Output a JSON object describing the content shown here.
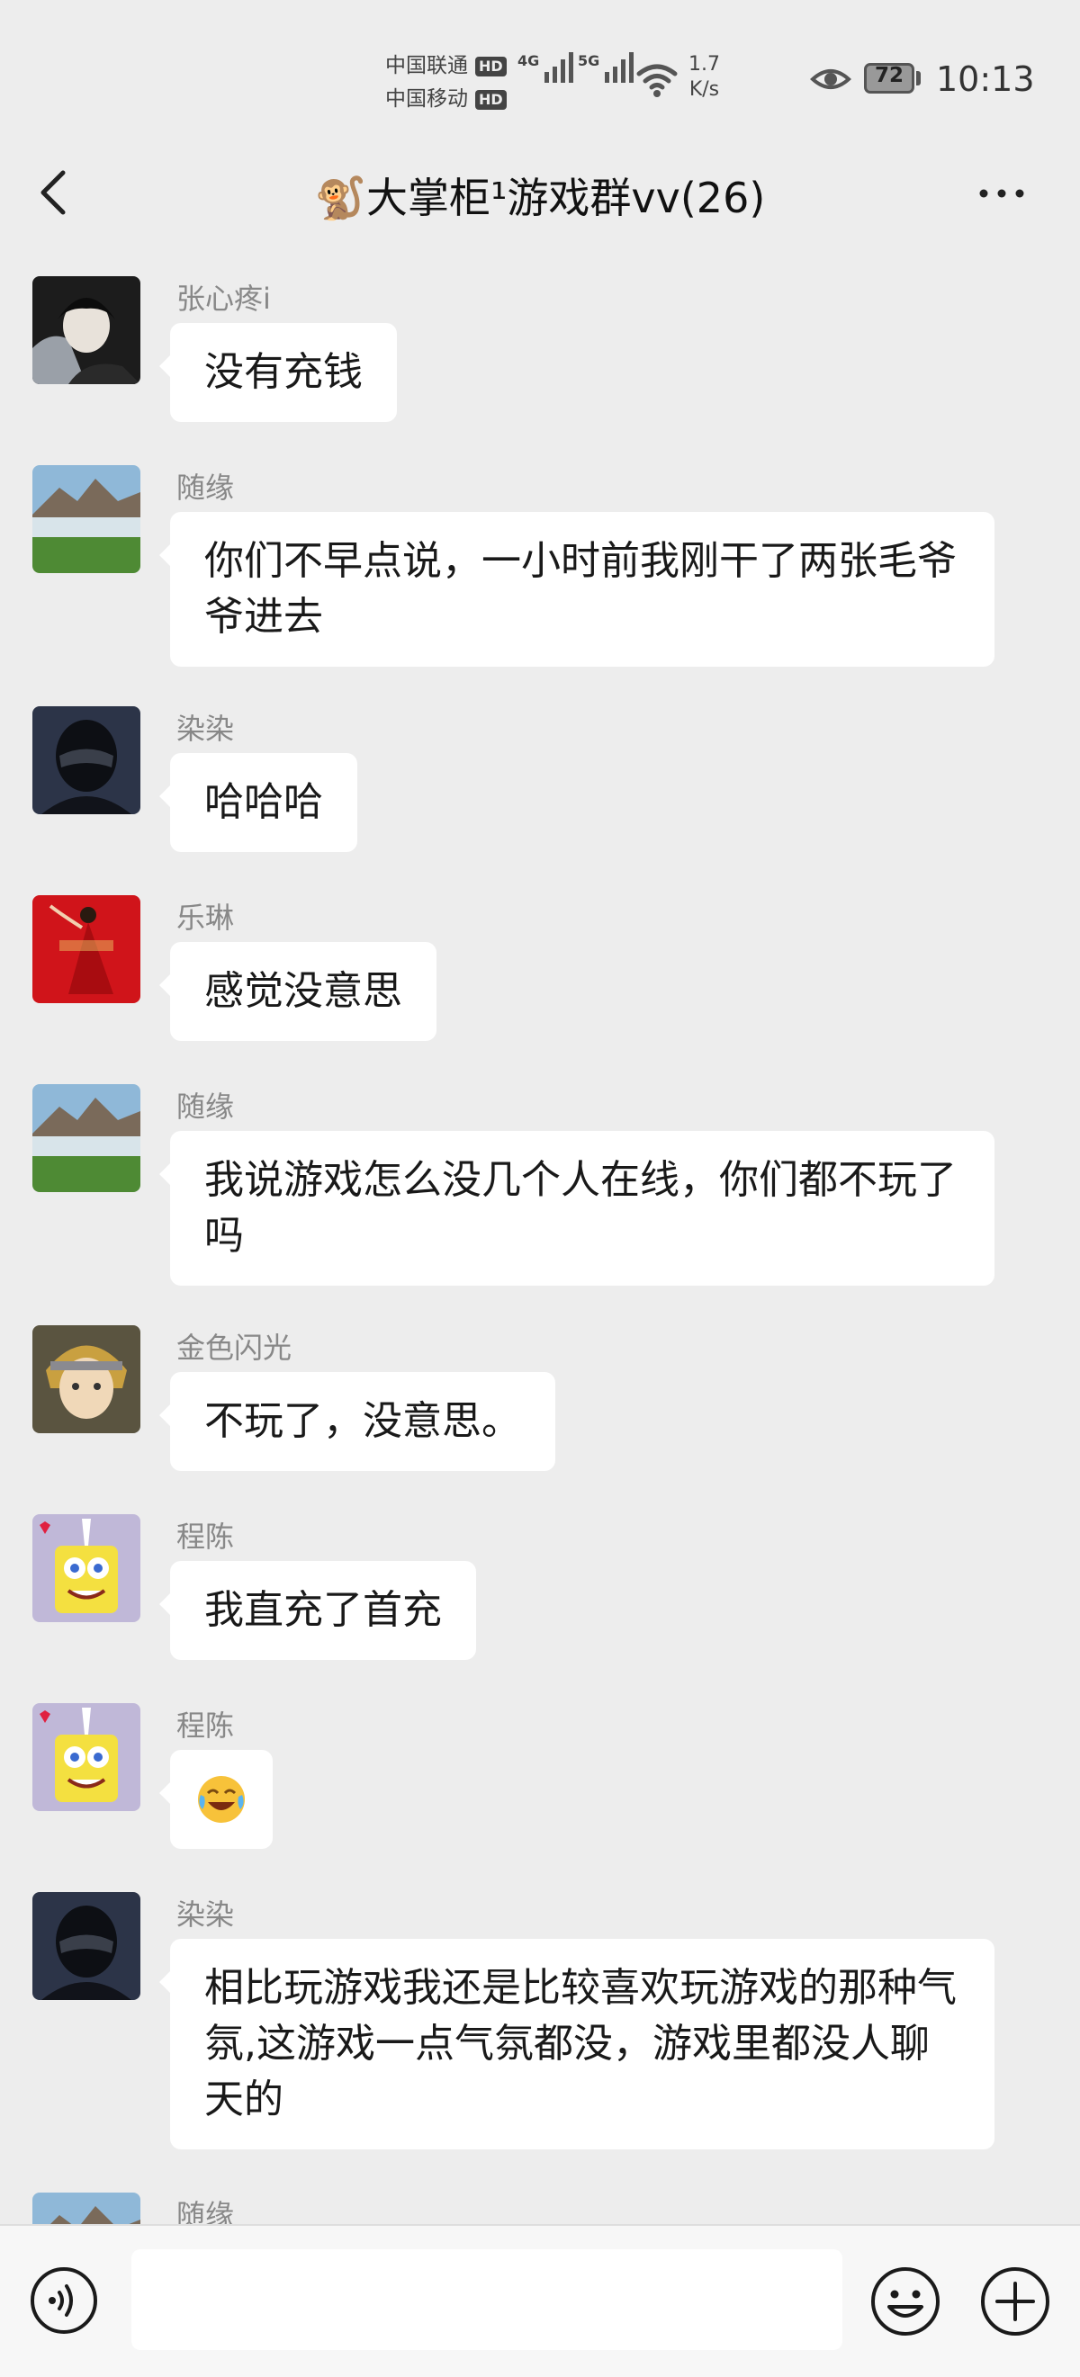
{
  "status": {
    "carrier1": "中国联通",
    "carrier2": "中国移动",
    "hd_badge": "HD",
    "net1_gen": "4G",
    "net2_gen": "5G",
    "speed_value": "1.7",
    "speed_unit": "K/s",
    "battery": "72",
    "time": "10:13"
  },
  "header": {
    "title": "🐒大掌柜¹游戏群vv(26)",
    "back_icon": "chevron-left-icon",
    "more_icon": "ellipsis-icon"
  },
  "messages": [
    {
      "sender": "张心疼i",
      "text": "没有充钱",
      "avatar": "anime-dark-hair-avatar"
    },
    {
      "sender": "随缘",
      "text": "你们不早点说，一小时前我刚干了两张毛爷爷进去",
      "avatar": "mountain-lake-avatar"
    },
    {
      "sender": "染染",
      "text": "哈哈哈",
      "avatar": "black-helmet-avatar"
    },
    {
      "sender": "乐琳",
      "text": "感觉没意思",
      "avatar": "red-dress-avatar"
    },
    {
      "sender": "随缘",
      "text": "我说游戏怎么没几个人在线，你们都不玩了吗",
      "avatar": "mountain-lake-avatar"
    },
    {
      "sender": "金色闪光",
      "text": "不玩了，没意思。",
      "avatar": "anime-blond-avatar"
    },
    {
      "sender": "程陈",
      "text": "我直充了首充",
      "avatar": "spongebob-avatar"
    },
    {
      "sender": "程陈",
      "text": "😂",
      "avatar": "spongebob-avatar"
    },
    {
      "sender": "染染",
      "text": "相比玩游戏我还是比较喜欢玩游戏的那种气氛,这游戏一点气氛都没，游戏里都没人聊天的",
      "avatar": "black-helmet-avatar"
    },
    {
      "sender": "随缘",
      "text": "",
      "avatar": "mountain-lake-avatar"
    }
  ],
  "input_bar": {
    "placeholder": "",
    "voice_icon": "voice-icon",
    "emoji_icon": "emoji-icon",
    "plus_icon": "plus-icon"
  }
}
